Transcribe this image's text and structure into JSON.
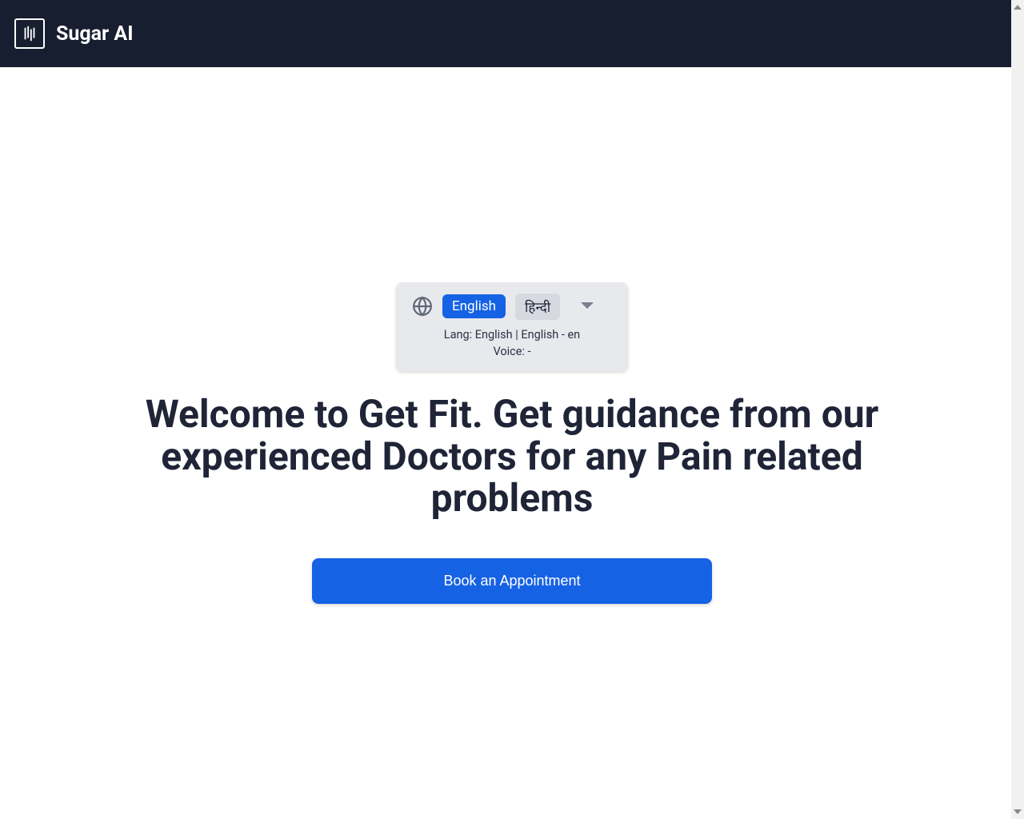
{
  "header": {
    "brand_name": "Sugar AI"
  },
  "language_selector": {
    "option_english": "English",
    "option_hindi": "हिन्दी",
    "info_line1": "Lang: English | English - en",
    "info_line2": "Voice: -"
  },
  "main": {
    "heading": "Welcome to Get Fit. Get guidance from our experienced Doctors for any Pain related problems",
    "cta_label": "Book an Appointment"
  }
}
